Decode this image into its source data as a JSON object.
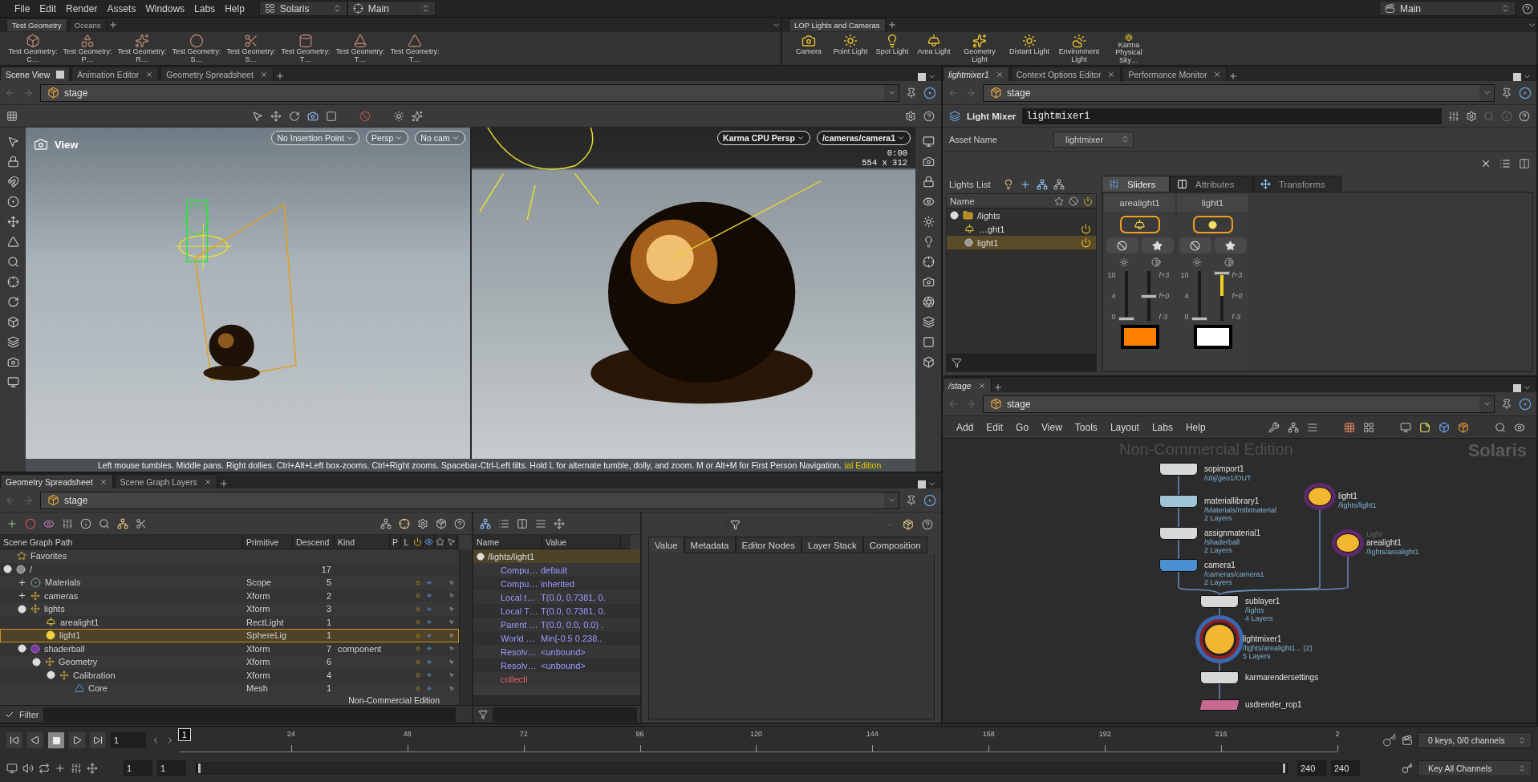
{
  "menu": [
    "File",
    "Edit",
    "Render",
    "Assets",
    "Windows",
    "Labs",
    "Help"
  ],
  "desktop": "Solaris",
  "layout": "Main",
  "right_desktop": "Main",
  "shelf_left": {
    "tabs": [
      {
        "label": "Test Geometry",
        "selected": true
      },
      {
        "label": "Oceans",
        "selected": false
      }
    ],
    "tools": [
      "Test Geometry: C…",
      "Test Geometry: P…",
      "Test Geometry: R…",
      "Test Geometry: S…",
      "Test Geometry: S…",
      "Test Geometry: T…",
      "Test Geometry: T…",
      "Test Geometry: T…"
    ]
  },
  "shelf_right": {
    "tabs": [
      {
        "label": "LOP Lights and Cameras",
        "selected": true
      }
    ],
    "tools": [
      "Camera",
      "Point Light",
      "Spot Light",
      "Area Light",
      "Geometry Light",
      "Distant Light",
      "Environment Light",
      "Karma Physical Sky…"
    ]
  },
  "scene_view": {
    "tabs": [
      {
        "label": "Scene View",
        "selected": true,
        "closable": false
      },
      {
        "label": "Animation Editor",
        "selected": false,
        "closable": true
      },
      {
        "label": "Geometry Spreadsheet",
        "selected": false,
        "closable": true
      }
    ],
    "path": "stage",
    "left_viewport": {
      "title": "View",
      "menus": [
        "No Insertion Point",
        "Persp",
        "No cam"
      ]
    },
    "right_viewport": {
      "menus": [
        "Karma CPU Persp",
        "/cameras/camera1"
      ],
      "time": "0:00",
      "resolution": "554 x 312"
    },
    "hint": "Left mouse tumbles. Middle pans. Right dollies. Ctrl+Alt+Left box-zooms. Ctrl+Right zooms. Spacebar-Ctrl-Left tilts. Hold L for alternate tumble, dolly, and zoom. M or Alt+M for First Person Navigation.",
    "watermark": "ial Edition"
  },
  "light_mixer": {
    "tabs": [
      {
        "label": "lightmixer1",
        "selected": true,
        "closable": true
      },
      {
        "label": "Context Options Editor",
        "selected": false,
        "closable": true
      },
      {
        "label": "Performance Monitor",
        "selected": false,
        "closable": true
      }
    ],
    "path": "stage",
    "node_type": "Light Mixer",
    "node_name": "lightmixer1",
    "asset_label": "Asset Name",
    "asset_value": "lightmixer",
    "list_title": "Lights List",
    "list_column": "Name",
    "tree": [
      {
        "name": "/lights",
        "kind": "folder",
        "expanded": true,
        "selected": false,
        "children": [
          {
            "name": "…ght1",
            "kind": "area",
            "selected": false,
            "enabled": true
          },
          {
            "name": "light1",
            "kind": "sphere",
            "selected": true,
            "enabled": true
          }
        ]
      }
    ],
    "mixer_tabs": [
      {
        "label": "Sliders",
        "selected": true
      },
      {
        "label": "Attributes",
        "selected": false
      },
      {
        "label": "Transforms",
        "selected": false
      }
    ],
    "channels": [
      {
        "name": "arealight1",
        "kind": "area",
        "enabled": true,
        "color": "#ff8000",
        "intensity": {
          "level": 0
        },
        "exposure": {
          "level": 0.5
        },
        "intensity_ticks": [
          "10",
          "4",
          "0"
        ],
        "exposure_ticks": [
          "f+3",
          "f+0",
          "f-3"
        ]
      },
      {
        "name": "light1",
        "kind": "sphere",
        "enabled": true,
        "color": "#ffffff",
        "intensity": {
          "level": 0
        },
        "exposure": {
          "level": 1
        },
        "intensity_ticks": [
          "10",
          "4",
          "0"
        ],
        "exposure_ticks": [
          "f+3",
          "f+0",
          "f-3"
        ]
      }
    ]
  },
  "network": {
    "tabs": [
      {
        "label": "/stage",
        "selected": true,
        "closable": true
      }
    ],
    "path": "stage",
    "menu": [
      "Add",
      "Edit",
      "Go",
      "View",
      "Tools",
      "Layout",
      "Labs",
      "Help"
    ],
    "watermark": "Non-Commercial Edition",
    "context": "Solaris",
    "nodes": [
      {
        "name": "sopimport1",
        "kind": "box",
        "color": "#d8d8d8",
        "info": [
          "/obj/geo1/OUT"
        ]
      },
      {
        "name": "materiallibrary1",
        "kind": "box",
        "color": "#9fc4d8",
        "info": [
          "/Materials/mtlxmaterial",
          "2 Layers"
        ]
      },
      {
        "name": "assignmaterial1",
        "kind": "box",
        "color": "#d8d8d8",
        "info": [
          "/shaderball",
          "2 Layers"
        ]
      },
      {
        "name": "camera1",
        "kind": "box",
        "color": "#4a90d0",
        "info": [
          "/cameras/camera1",
          "2 Layers"
        ]
      },
      {
        "name": "light1",
        "kind": "light",
        "color": "#f2b630",
        "info": [
          "/lights/light1"
        ]
      },
      {
        "name": "arealight1",
        "kind": "light",
        "color": "#f2b630",
        "comment": "Light",
        "info": [
          "/lights/arealight1"
        ]
      },
      {
        "name": "sublayer1",
        "kind": "box",
        "color": "#d8d8d8",
        "info": [
          "/lights",
          "4 Layers"
        ]
      },
      {
        "name": "lightmixer1",
        "kind": "mixer",
        "color": "#f2b630",
        "info": [
          "/lights/arealight1... (2)",
          "5 Layers"
        ]
      },
      {
        "name": "karmarendersettings",
        "kind": "box",
        "color": "#d8d8d8"
      },
      {
        "name": "usdrender_rop1",
        "kind": "rop",
        "color": "#c86a90"
      }
    ]
  },
  "spreadsheet": {
    "tabs": [
      {
        "label": "Geometry Spreadsheet",
        "selected": true,
        "closable": true
      },
      {
        "label": "Scene Graph Layers",
        "selected": false,
        "closable": true
      }
    ],
    "path": "stage",
    "columns": [
      "Scene Graph Path",
      "Primitive",
      "Descend",
      "Kind",
      "P",
      "L"
    ],
    "rows": [
      {
        "name": "Favorites",
        "kind": "favorites",
        "selected": false
      },
      {
        "name": "/",
        "kind": "root",
        "descendants": "17",
        "expanded": true,
        "selected": false,
        "children": [
          {
            "name": "Materials",
            "kind": "scope",
            "primitive": "Scope",
            "descendants": "5",
            "expanded": false,
            "selected": false,
            "active": true,
            "visible": true
          },
          {
            "name": "cameras",
            "kind": "xform",
            "primitive": "Xform",
            "descendants": "2",
            "expanded": false,
            "selected": false,
            "active": true,
            "visible": true
          },
          {
            "name": "lights",
            "kind": "xform",
            "primitive": "Xform",
            "descendants": "3",
            "expanded": true,
            "selected": false,
            "active": true,
            "visible": true,
            "children": [
              {
                "name": "arealight1",
                "kind": "rectlight",
                "primitive": "RectLight",
                "descendants": "1",
                "selected": false,
                "active": true,
                "visible": true
              },
              {
                "name": "light1",
                "kind": "spherelight",
                "primitive": "SphereLig",
                "descendants": "1",
                "selected": true,
                "active": true,
                "visible": true
              }
            ]
          },
          {
            "name": "shaderball",
            "kind": "component",
            "primitive": "Xform",
            "descendants": "7",
            "usd_kind": "component",
            "expanded": true,
            "selected": false,
            "active": true,
            "visible": true,
            "children": [
              {
                "name": "Geometry",
                "kind": "xform",
                "primitive": "Xform",
                "descendants": "6",
                "expanded": true,
                "selected": false,
                "active": true,
                "visible": true,
                "children": [
                  {
                    "name": "Calibration",
                    "kind": "xform",
                    "primitive": "Xform",
                    "descendants": "4",
                    "expanded": true,
                    "selected": false,
                    "active": true,
                    "visible": true,
                    "children": [
                      {
                        "name": "Core",
                        "kind": "mesh",
                        "primitive": "Mesh",
                        "descendants": "1",
                        "selected": false,
                        "active": true,
                        "visible": true
                      }
                    ]
                  }
                ]
              }
            ]
          }
        ]
      }
    ],
    "watermark": "Non-Commercial Edition",
    "filter_label": "Filter",
    "properties": {
      "columns": [
        "Name",
        "Value"
      ],
      "root": {
        "name": "/lights/light1",
        "expanded": true
      },
      "rows": [
        {
          "name": "Compu…",
          "value": "default",
          "kind": "attribute"
        },
        {
          "name": "Compu…",
          "value": "inherited",
          "kind": "attribute"
        },
        {
          "name": "Local t…",
          "value": "T(0.0, 0.7381, 0.",
          "kind": "attribute"
        },
        {
          "name": "Local T…",
          "value": "T(0.0, 0.7381, 0.",
          "kind": "attribute"
        },
        {
          "name": "Parent …",
          "value": "T(0.0, 0.0, 0.0) .",
          "kind": "attribute"
        },
        {
          "name": "World …",
          "value": "Min[-0.5 0.238..",
          "kind": "attribute"
        },
        {
          "name": "Resolv…",
          "value": "<unbound>",
          "kind": "attribute"
        },
        {
          "name": "Resolv…",
          "value": "<unbound>",
          "kind": "attribute"
        },
        {
          "name": "collecti",
          "kind": "collection"
        }
      ]
    },
    "detail_tabs": [
      {
        "label": "Value",
        "selected": true
      },
      {
        "label": "Metadata",
        "selected": false
      },
      {
        "label": "Editor Nodes",
        "selected": false
      },
      {
        "label": "Layer Stack",
        "selected": false
      },
      {
        "label": "Composition",
        "selected": false
      }
    ]
  },
  "timeline": {
    "frame": "1",
    "marker": "1",
    "playhead": {
      "level": 0
    },
    "ticks": [
      "24",
      "48",
      "72",
      "96",
      "120",
      "144",
      "168",
      "192",
      "216",
      "2"
    ],
    "start": "1",
    "range": {
      "level": 1
    },
    "range_start": "1",
    "range_end": "240",
    "end": "240",
    "keys": "0 keys, 0/0 channels",
    "key_button": "Key All Channels"
  }
}
